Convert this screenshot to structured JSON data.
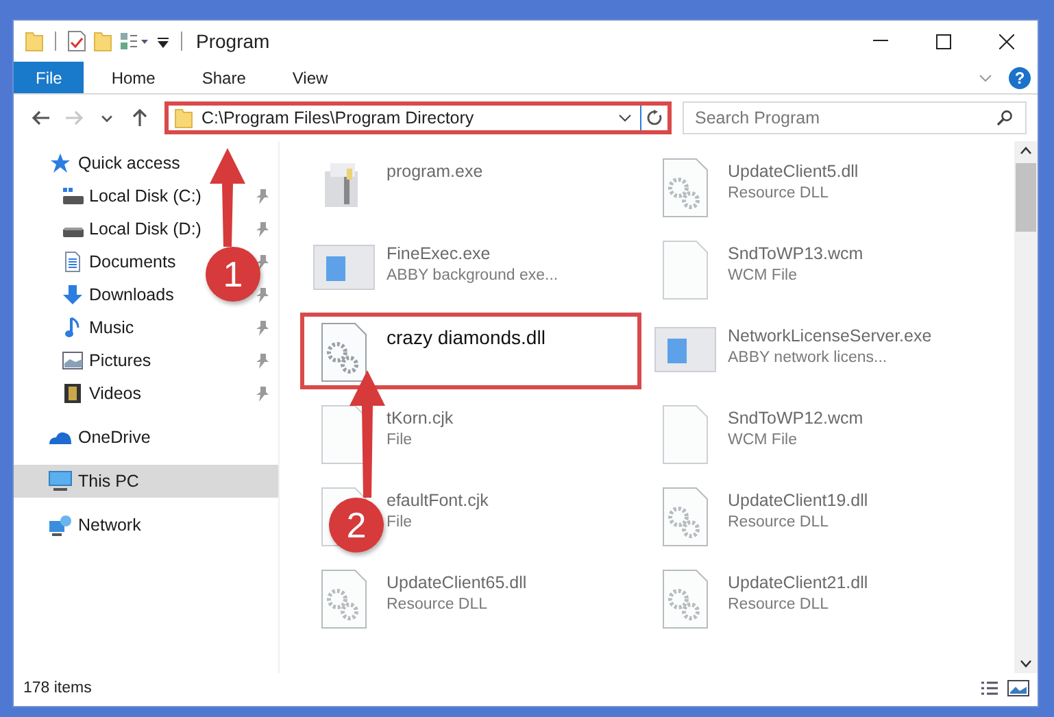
{
  "window": {
    "title": "Program"
  },
  "ribbon": {
    "tabs": [
      {
        "label": "File",
        "selected": true
      },
      {
        "label": "Home",
        "selected": false
      },
      {
        "label": "Share",
        "selected": false
      },
      {
        "label": "View",
        "selected": false
      }
    ],
    "help": "?"
  },
  "nav_buttons": [
    {
      "kind": "back",
      "disabled": false
    },
    {
      "kind": "forward",
      "disabled": true
    },
    {
      "kind": "recent",
      "disabled": false
    },
    {
      "kind": "up",
      "disabled": false
    }
  ],
  "address_bar": {
    "value": "C:\\Program Files\\Program Directory",
    "highlighted": true
  },
  "search": {
    "placeholder": "Search Program"
  },
  "sidebar": {
    "items": [
      {
        "label": "Quick access",
        "kind": "star",
        "selected": false,
        "children": [
          {
            "label": "Local Disk (C:)",
            "kind": "system-drive",
            "pinned": true
          },
          {
            "label": "Local Disk (D:)",
            "kind": "drive",
            "pinned": true
          },
          {
            "label": "Documents",
            "kind": "document",
            "pinned": true
          },
          {
            "label": "Downloads",
            "kind": "download",
            "pinned": true
          },
          {
            "label": "Music",
            "kind": "music",
            "pinned": true
          },
          {
            "label": "Pictures",
            "kind": "pictures",
            "pinned": true
          },
          {
            "label": "Videos",
            "kind": "videos",
            "pinned": true
          }
        ]
      },
      {
        "label": "OneDrive",
        "kind": "cloud",
        "selected": false
      },
      {
        "label": "This PC",
        "kind": "pc",
        "selected": true
      },
      {
        "label": "Network",
        "kind": "network",
        "selected": false
      }
    ]
  },
  "files": [
    {
      "name": "program.exe",
      "kind": "installer",
      "highlighted": false
    },
    {
      "name": "UpdateClient5.dll",
      "type": "Resource DLL",
      "kind": "dll",
      "highlighted": false
    },
    {
      "name": "FineExec.exe",
      "type": "ABBY background exe...",
      "kind": "app",
      "highlighted": false
    },
    {
      "name": "SndToWP13.wcm",
      "type": "WCM File",
      "kind": "file",
      "highlighted": false
    },
    {
      "name": "crazy diamonds.dll",
      "kind": "dll",
      "highlighted": true
    },
    {
      "name": "NetworkLicenseServer.exe",
      "type": "ABBY network licens...",
      "kind": "app",
      "highlighted": false
    },
    {
      "name": "tKorn.cjk",
      "type": "File",
      "kind": "file",
      "highlighted": false
    },
    {
      "name": "SndToWP12.wcm",
      "type": "WCM File",
      "kind": "file",
      "highlighted": false
    },
    {
      "name": "efaultFont.cjk",
      "type": "File",
      "kind": "file",
      "highlighted": false
    },
    {
      "name": "UpdateClient19.dll",
      "type": "Resource DLL",
      "kind": "dll",
      "highlighted": false
    },
    {
      "name": "UpdateClient65.dll",
      "type": "Resource DLL",
      "kind": "dll",
      "highlighted": false
    },
    {
      "name": "UpdateClient21.dll",
      "type": "Resource DLL",
      "kind": "dll",
      "highlighted": false
    }
  ],
  "status_bar": {
    "item_count": "178 items"
  },
  "callouts": [
    {
      "label": "1"
    },
    {
      "label": "2"
    }
  ]
}
